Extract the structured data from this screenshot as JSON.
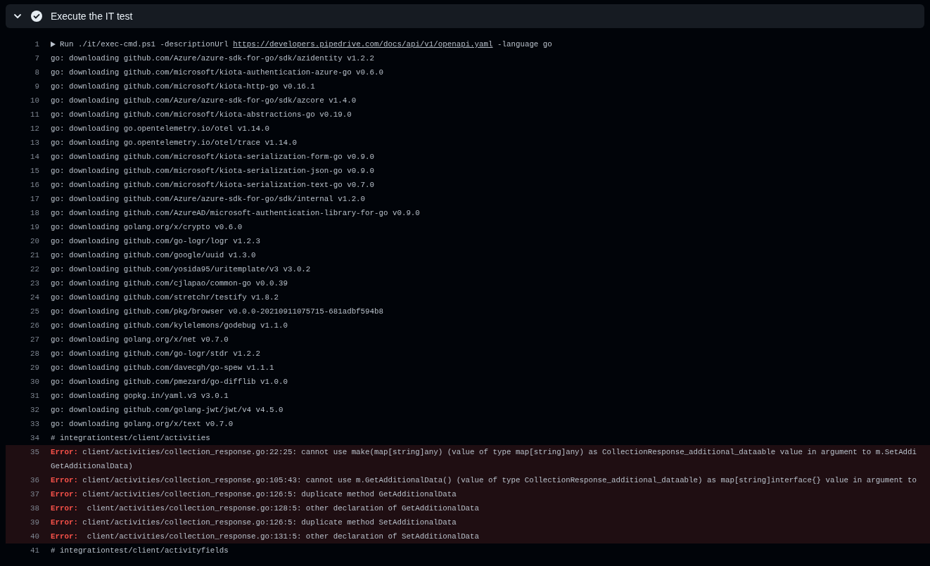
{
  "step": {
    "title": "Execute the IT test",
    "succeeded": true,
    "expanded": true
  },
  "lines": [
    {
      "number": "1",
      "kind": "command",
      "expanded": false,
      "prefix": "Run ./it/exec-cmd.ps1 -descriptionUrl ",
      "link": "https://developers.pipedrive.com/docs/api/v1/openapi.yaml",
      "suffix": " -language go"
    },
    {
      "number": "7",
      "kind": "output",
      "text": "go: downloading github.com/Azure/azure-sdk-for-go/sdk/azidentity v1.2.2"
    },
    {
      "number": "8",
      "kind": "output",
      "text": "go: downloading github.com/microsoft/kiota-authentication-azure-go v0.6.0"
    },
    {
      "number": "9",
      "kind": "output",
      "text": "go: downloading github.com/microsoft/kiota-http-go v0.16.1"
    },
    {
      "number": "10",
      "kind": "output",
      "text": "go: downloading github.com/Azure/azure-sdk-for-go/sdk/azcore v1.4.0"
    },
    {
      "number": "11",
      "kind": "output",
      "text": "go: downloading github.com/microsoft/kiota-abstractions-go v0.19.0"
    },
    {
      "number": "12",
      "kind": "output",
      "text": "go: downloading go.opentelemetry.io/otel v1.14.0"
    },
    {
      "number": "13",
      "kind": "output",
      "text": "go: downloading go.opentelemetry.io/otel/trace v1.14.0"
    },
    {
      "number": "14",
      "kind": "output",
      "text": "go: downloading github.com/microsoft/kiota-serialization-form-go v0.9.0"
    },
    {
      "number": "15",
      "kind": "output",
      "text": "go: downloading github.com/microsoft/kiota-serialization-json-go v0.9.0"
    },
    {
      "number": "16",
      "kind": "output",
      "text": "go: downloading github.com/microsoft/kiota-serialization-text-go v0.7.0"
    },
    {
      "number": "17",
      "kind": "output",
      "text": "go: downloading github.com/Azure/azure-sdk-for-go/sdk/internal v1.2.0"
    },
    {
      "number": "18",
      "kind": "output",
      "text": "go: downloading github.com/AzureAD/microsoft-authentication-library-for-go v0.9.0"
    },
    {
      "number": "19",
      "kind": "output",
      "text": "go: downloading golang.org/x/crypto v0.6.0"
    },
    {
      "number": "20",
      "kind": "output",
      "text": "go: downloading github.com/go-logr/logr v1.2.3"
    },
    {
      "number": "21",
      "kind": "output",
      "text": "go: downloading github.com/google/uuid v1.3.0"
    },
    {
      "number": "22",
      "kind": "output",
      "text": "go: downloading github.com/yosida95/uritemplate/v3 v3.0.2"
    },
    {
      "number": "23",
      "kind": "output",
      "text": "go: downloading github.com/cjlapao/common-go v0.0.39"
    },
    {
      "number": "24",
      "kind": "output",
      "text": "go: downloading github.com/stretchr/testify v1.8.2"
    },
    {
      "number": "25",
      "kind": "output",
      "text": "go: downloading github.com/pkg/browser v0.0.0-20210911075715-681adbf594b8"
    },
    {
      "number": "26",
      "kind": "output",
      "text": "go: downloading github.com/kylelemons/godebug v1.1.0"
    },
    {
      "number": "27",
      "kind": "output",
      "text": "go: downloading golang.org/x/net v0.7.0"
    },
    {
      "number": "28",
      "kind": "output",
      "text": "go: downloading github.com/go-logr/stdr v1.2.2"
    },
    {
      "number": "29",
      "kind": "output",
      "text": "go: downloading github.com/davecgh/go-spew v1.1.1"
    },
    {
      "number": "30",
      "kind": "output",
      "text": "go: downloading github.com/pmezard/go-difflib v1.0.0"
    },
    {
      "number": "31",
      "kind": "output",
      "text": "go: downloading gopkg.in/yaml.v3 v3.0.1"
    },
    {
      "number": "32",
      "kind": "output",
      "text": "go: downloading github.com/golang-jwt/jwt/v4 v4.5.0"
    },
    {
      "number": "33",
      "kind": "output",
      "text": "go: downloading golang.org/x/text v0.7.0"
    },
    {
      "number": "34",
      "kind": "output",
      "text": "# integrationtest/client/activities"
    },
    {
      "number": "35",
      "kind": "error",
      "label": "Error:",
      "text": " client/activities/collection_response.go:22:25: cannot use make(map[string]any) (value of type map[string]any) as CollectionResponse_additional_dataable value in argument to m.SetAddi",
      "wrap": "GetAdditionalData)"
    },
    {
      "number": "36",
      "kind": "error",
      "label": "Error:",
      "text": " client/activities/collection_response.go:105:43: cannot use m.GetAdditionalData() (value of type CollectionResponse_additional_dataable) as map[string]interface{} value in argument to"
    },
    {
      "number": "37",
      "kind": "error",
      "label": "Error:",
      "text": " client/activities/collection_response.go:126:5: duplicate method GetAdditionalData"
    },
    {
      "number": "38",
      "kind": "error",
      "label": "Error:",
      "text": "  client/activities/collection_response.go:128:5: other declaration of GetAdditionalData"
    },
    {
      "number": "39",
      "kind": "error",
      "label": "Error:",
      "text": " client/activities/collection_response.go:126:5: duplicate method SetAdditionalData"
    },
    {
      "number": "40",
      "kind": "error",
      "label": "Error:",
      "text": "  client/activities/collection_response.go:131:5: other declaration of SetAdditionalData"
    },
    {
      "number": "41",
      "kind": "output",
      "text": "# integrationtest/client/activityfields"
    }
  ]
}
